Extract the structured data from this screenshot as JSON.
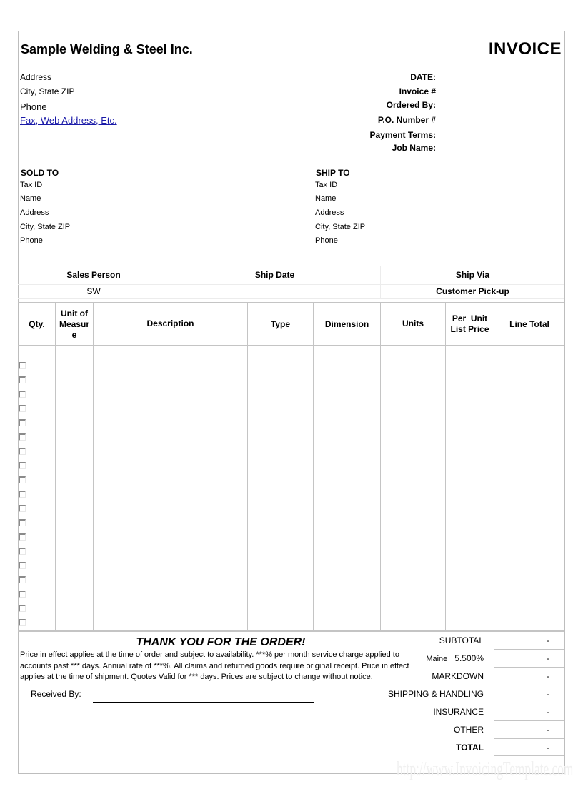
{
  "header": {
    "company_name": "Sample Welding & Steel Inc.",
    "document_title": "INVOICE",
    "company_address": "Address",
    "company_city": "City, State ZIP",
    "company_phone": "Phone",
    "company_link": "Fax, Web Address, Etc."
  },
  "meta": {
    "date_label": "DATE:",
    "invoice_label": "Invoice #",
    "ordered_by_label": "Ordered By:",
    "po_label": "P.O. Number #",
    "payment_terms_label": "Payment Terms:",
    "job_name_label": "Job Name:"
  },
  "sold_to": {
    "title": "SOLD  TO",
    "lines": [
      "Tax ID",
      "Name",
      "Address",
      "City, State ZIP",
      "Phone"
    ]
  },
  "ship_to": {
    "title": "SHIP TO",
    "lines": [
      "Tax ID",
      "Name",
      "Address",
      "City, State ZIP",
      "Phone"
    ]
  },
  "shipping_info": {
    "headers": [
      "Sales Person",
      "Ship Date",
      "Ship Via"
    ],
    "values": [
      "SW",
      "",
      "Customer Pick-up"
    ]
  },
  "items_table": {
    "columns": [
      "Qty.",
      "Unit of Measur e",
      "Description",
      "Type",
      "Dimension",
      "Units",
      "Per  Unit List Price",
      "Line Total"
    ],
    "column_lines": {
      "qty": "Qty.",
      "uom_1": "Unit of",
      "uom_2": "Measur",
      "uom_3": "e",
      "description": "Description",
      "type": "Type",
      "dimension": "Dimension",
      "units": "Units",
      "price_1": "Per  Unit",
      "price_2": "List Price",
      "line_total": "Line Total"
    },
    "row_count": 19
  },
  "footer": {
    "thank_you": "THANK YOU FOR THE ORDER!",
    "terms": "Price in effect applies at the time of order and subject to availability. ***% per month service charge applied to accounts past *** days. Annual rate of ***%. All claims and returned goods require original receipt. Price in effect applies at the time of shipment. Quotes Valid for *** days. Prices are subject to change without notice.",
    "received_by_label": "Received By:"
  },
  "totals": {
    "subtotal_label": "SUBTOTAL",
    "subtotal_value": "-",
    "tax_state": "Maine",
    "tax_rate": "5.500%",
    "tax_value": "-",
    "markdown_label": "MARKDOWN",
    "markdown_value": "-",
    "shipping_label": "SHIPPING & HANDLING",
    "shipping_value": "-",
    "insurance_label": "INSURANCE",
    "insurance_value": "-",
    "other_label": "OTHER",
    "other_value": "-",
    "total_label": "TOTAL",
    "total_value": "-"
  },
  "watermark": "http://www.InvoicingTemplate.com",
  "colors": {
    "link": "#1a1aa8",
    "grid": "#c4c4c4",
    "frame": "#bdbdbd"
  }
}
